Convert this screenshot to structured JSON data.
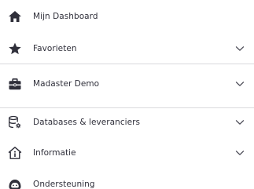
{
  "nav": {
    "items": [
      {
        "label": "Mijn Dashboard",
        "icon": "home-icon",
        "expandable": false
      },
      {
        "label": "Favorieten",
        "icon": "star-icon",
        "expandable": true
      },
      {
        "label": "Madaster Demo",
        "icon": "briefcase-icon",
        "expandable": true
      },
      {
        "label": "Databases & leveranciers",
        "icon": "database-settings-icon",
        "expandable": true
      },
      {
        "label": "Informatie",
        "icon": "info-house-icon",
        "expandable": true
      },
      {
        "label": "Ondersteuning",
        "icon": "support-face-icon",
        "expandable": false
      }
    ]
  },
  "colors": {
    "text": "#2f2f3a",
    "icon": "#2f2f3a",
    "chevron": "#4a4a55",
    "divider": "#d9d9dd",
    "background": "#ffffff"
  }
}
